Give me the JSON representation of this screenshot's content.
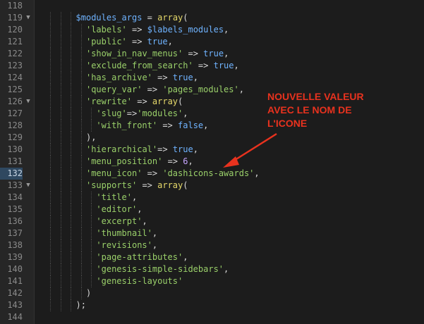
{
  "editor": {
    "lines": [
      {
        "num": "118",
        "fold": false,
        "tokens": []
      },
      {
        "num": "119",
        "fold": true,
        "tokens": [
          {
            "t": "$modules_args",
            "c": "var"
          },
          {
            "t": " = ",
            "c": "op"
          },
          {
            "t": "array",
            "c": "fn"
          },
          {
            "t": "(",
            "c": "pun"
          }
        ]
      },
      {
        "num": "120",
        "fold": false,
        "tokens": [
          {
            "t": "'labels'",
            "c": "str"
          },
          {
            "t": " => ",
            "c": "op"
          },
          {
            "t": "$labels_modules",
            "c": "var"
          },
          {
            "t": ",",
            "c": "pun"
          }
        ]
      },
      {
        "num": "121",
        "fold": false,
        "tokens": [
          {
            "t": "'public'",
            "c": "str"
          },
          {
            "t": " => ",
            "c": "op"
          },
          {
            "t": "true",
            "c": "bool"
          },
          {
            "t": ",",
            "c": "pun"
          }
        ]
      },
      {
        "num": "122",
        "fold": false,
        "tokens": [
          {
            "t": "'show_in_nav_menus'",
            "c": "str"
          },
          {
            "t": " => ",
            "c": "op"
          },
          {
            "t": "true",
            "c": "bool"
          },
          {
            "t": ",",
            "c": "pun"
          }
        ]
      },
      {
        "num": "123",
        "fold": false,
        "tokens": [
          {
            "t": "'exclude_from_search'",
            "c": "str"
          },
          {
            "t": " => ",
            "c": "op"
          },
          {
            "t": "true",
            "c": "bool"
          },
          {
            "t": ",",
            "c": "pun"
          }
        ]
      },
      {
        "num": "124",
        "fold": false,
        "tokens": [
          {
            "t": "'has_archive'",
            "c": "str"
          },
          {
            "t": " => ",
            "c": "op"
          },
          {
            "t": "true",
            "c": "bool"
          },
          {
            "t": ",",
            "c": "pun"
          }
        ]
      },
      {
        "num": "125",
        "fold": false,
        "tokens": [
          {
            "t": "'query_var'",
            "c": "str"
          },
          {
            "t": " => ",
            "c": "op"
          },
          {
            "t": "'pages_modules'",
            "c": "str"
          },
          {
            "t": ",",
            "c": "pun"
          }
        ]
      },
      {
        "num": "126",
        "fold": true,
        "tokens": [
          {
            "t": "'rewrite'",
            "c": "str"
          },
          {
            "t": " => ",
            "c": "op"
          },
          {
            "t": "array",
            "c": "fn"
          },
          {
            "t": "(",
            "c": "pun"
          }
        ]
      },
      {
        "num": "127",
        "fold": false,
        "tokens": [
          {
            "t": "'slug'",
            "c": "str"
          },
          {
            "t": "=>",
            "c": "op"
          },
          {
            "t": "'modules'",
            "c": "str"
          },
          {
            "t": ",",
            "c": "pun"
          }
        ]
      },
      {
        "num": "128",
        "fold": false,
        "tokens": [
          {
            "t": "'with_front'",
            "c": "str"
          },
          {
            "t": " => ",
            "c": "op"
          },
          {
            "t": "false",
            "c": "bool"
          },
          {
            "t": ",",
            "c": "pun"
          }
        ]
      },
      {
        "num": "129",
        "fold": false,
        "tokens": [
          {
            "t": "),",
            "c": "pun"
          }
        ]
      },
      {
        "num": "130",
        "fold": false,
        "tokens": [
          {
            "t": "'hierarchical'",
            "c": "str"
          },
          {
            "t": "=> ",
            "c": "op"
          },
          {
            "t": "true",
            "c": "bool"
          },
          {
            "t": ",",
            "c": "pun"
          }
        ]
      },
      {
        "num": "131",
        "fold": false,
        "tokens": [
          {
            "t": "'menu_position'",
            "c": "str"
          },
          {
            "t": " => ",
            "c": "op"
          },
          {
            "t": "6",
            "c": "num"
          },
          {
            "t": ",",
            "c": "pun"
          }
        ]
      },
      {
        "num": "132",
        "fold": false,
        "highlight": true,
        "tokens": [
          {
            "t": "'menu_icon'",
            "c": "str"
          },
          {
            "t": " => ",
            "c": "op"
          },
          {
            "t": "'dashicons-awards'",
            "c": "str"
          },
          {
            "t": ",",
            "c": "pun"
          }
        ]
      },
      {
        "num": "133",
        "fold": true,
        "tokens": [
          {
            "t": "'supports'",
            "c": "str"
          },
          {
            "t": " => ",
            "c": "op"
          },
          {
            "t": "array",
            "c": "fn"
          },
          {
            "t": "(",
            "c": "pun"
          }
        ]
      },
      {
        "num": "134",
        "fold": false,
        "tokens": [
          {
            "t": "'title'",
            "c": "str"
          },
          {
            "t": ",",
            "c": "pun"
          }
        ]
      },
      {
        "num": "135",
        "fold": false,
        "tokens": [
          {
            "t": "'editor'",
            "c": "str"
          },
          {
            "t": ",",
            "c": "pun"
          }
        ]
      },
      {
        "num": "136",
        "fold": false,
        "tokens": [
          {
            "t": "'excerpt'",
            "c": "str"
          },
          {
            "t": ",",
            "c": "pun"
          }
        ]
      },
      {
        "num": "137",
        "fold": false,
        "tokens": [
          {
            "t": "'thumbnail'",
            "c": "str"
          },
          {
            "t": ",",
            "c": "pun"
          }
        ]
      },
      {
        "num": "138",
        "fold": false,
        "tokens": [
          {
            "t": "'revisions'",
            "c": "str"
          },
          {
            "t": ",",
            "c": "pun"
          }
        ]
      },
      {
        "num": "139",
        "fold": false,
        "tokens": [
          {
            "t": "'page-attributes'",
            "c": "str"
          },
          {
            "t": ",",
            "c": "pun"
          }
        ]
      },
      {
        "num": "140",
        "fold": false,
        "tokens": [
          {
            "t": "'genesis-simple-sidebars'",
            "c": "str"
          },
          {
            "t": ",",
            "c": "pun"
          }
        ]
      },
      {
        "num": "141",
        "fold": false,
        "tokens": [
          {
            "t": "'genesis-layouts'",
            "c": "str"
          }
        ]
      },
      {
        "num": "142",
        "fold": false,
        "tokens": [
          {
            "t": ")",
            "c": "pun"
          }
        ]
      },
      {
        "num": "143",
        "fold": false,
        "tokens": [
          {
            "t": ");",
            "c": "pun"
          }
        ]
      },
      {
        "num": "144",
        "fold": false,
        "tokens": []
      }
    ]
  },
  "annotation": {
    "lines": [
      "NOUVELLE VALEUR",
      "AVEC LE NOM DE",
      "L'ICONE"
    ]
  },
  "colors": {
    "background": "#1c1c1c",
    "gutter": "#262626",
    "highlight_line": "#2f4860",
    "annotation": "#e8321e"
  },
  "icons": {
    "fold_marker": "triangle-down-icon",
    "arrow": "red-arrow-icon"
  }
}
